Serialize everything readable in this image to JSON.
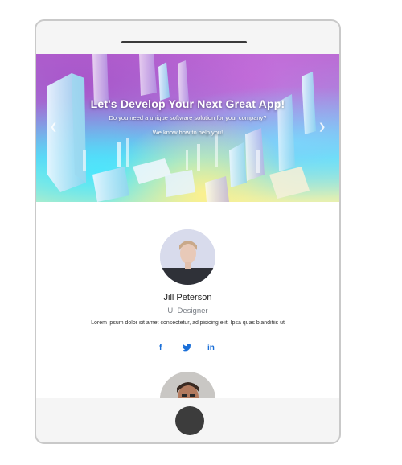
{
  "hero": {
    "title": "Let's Develop Your Next Great App!",
    "subtitle": "Do you need a unique software solution for your company?",
    "tagline": "We know how to help you!",
    "prev_icon": "chevron-left-icon",
    "next_icon": "chevron-right-icon"
  },
  "team": [
    {
      "name": "Jill Peterson",
      "role": "UI Designer",
      "description": "Lorem ipsum dolor sit amet consectetur, adipisicing elit. Ipsa quas blanditiis ut",
      "social": [
        "facebook-icon",
        "twitter-icon",
        "linkedin-icon"
      ]
    }
  ],
  "social_glyphs": {
    "facebook": "f",
    "twitter": "🐦",
    "linkedin": "in"
  },
  "colors": {
    "accent": "#1a6fd8",
    "role_text": "#7a7f86",
    "device_frame": "#c9c9c9",
    "home_button": "#3c3c3c"
  }
}
